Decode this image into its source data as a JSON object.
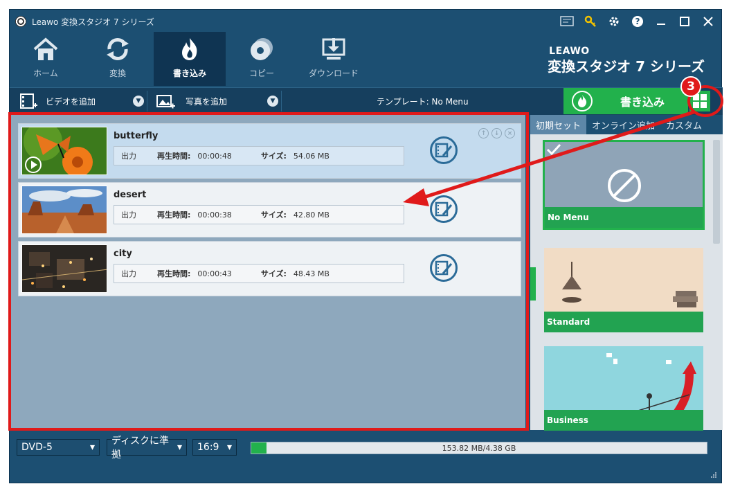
{
  "window": {
    "title": "Leawo 変換スタジオ 7 シリーズ",
    "controls": [
      "chat-icon",
      "key-icon",
      "gear-icon",
      "help-icon",
      "minimize-icon",
      "maximize-icon",
      "close-icon"
    ]
  },
  "nav": {
    "items": [
      {
        "label": "ホーム",
        "icon": "home-icon"
      },
      {
        "label": "変換",
        "icon": "convert-icon"
      },
      {
        "label": "書き込み",
        "icon": "burn-icon",
        "active": true
      },
      {
        "label": "コピー",
        "icon": "copy-disc-icon"
      },
      {
        "label": "ダウンロード",
        "icon": "download-icon"
      }
    ]
  },
  "brand": {
    "logo": "LEAWO",
    "name": "変換スタジオ 7 シリーズ"
  },
  "toolbar": {
    "add_video": "ビデオを追加",
    "add_photo": "写真を追加",
    "template": "テンプレート: No Menu",
    "burn": "書き込み"
  },
  "files": [
    {
      "name": "butterfly",
      "output": "出力",
      "duration_label": "再生時間:",
      "duration": "00:00:48",
      "size_label": "サイズ:",
      "size": "54.06 MB"
    },
    {
      "name": "desert",
      "output": "出力",
      "duration_label": "再生時間:",
      "duration": "00:00:38",
      "size_label": "サイズ:",
      "size": "42.80 MB"
    },
    {
      "name": "city",
      "output": "出力",
      "duration_label": "再生時間:",
      "duration": "00:00:43",
      "size_label": "サイズ:",
      "size": "48.43 MB"
    }
  ],
  "panel": {
    "tabs": [
      "初期セット",
      "オンライン追加",
      "カスタム"
    ],
    "templates": [
      {
        "label": "No Menu",
        "selected": true
      },
      {
        "label": "Standard"
      },
      {
        "label": "Business"
      }
    ]
  },
  "bottom": {
    "disc_type": "DVD-5",
    "quality": "ディスクに準拠",
    "aspect": "16:9",
    "usage": "153.82 MB/4.38 GB",
    "usage_fraction": 0.034
  },
  "annotation": {
    "step": "3"
  },
  "colors": {
    "window": "#1c4f72",
    "accent_green": "#22b14c",
    "annotation_red": "#e01a1a"
  }
}
